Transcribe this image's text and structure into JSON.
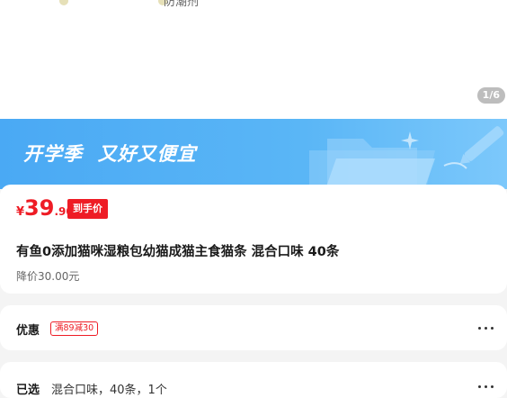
{
  "gallery": {
    "cut_text": "防潮剂",
    "counter": "1/6"
  },
  "banner": {
    "title": "开学季  又好又便宜",
    "icon": "folder-icon",
    "colors": {
      "bg": "#4aa9f4",
      "art": "#8ecdf9"
    }
  },
  "product": {
    "currency": "¥",
    "price_int": "39",
    "price_dec": ".90",
    "price_badge": "到手价",
    "title": "有鱼0添加猫咪湿粮包幼猫成猫主食猫条 混合口味 40条",
    "reduced_price": "降价30.00元"
  },
  "promotion": {
    "label": "优惠",
    "coupon": "满89减30",
    "more_icon": "more-dots-icon"
  },
  "selected": {
    "label": "已选",
    "value": "混合口味，40条，1个",
    "more_icon": "more-dots-icon"
  },
  "colors": {
    "accent": "#ee1c25",
    "page_bg": "#f4f4f4"
  }
}
